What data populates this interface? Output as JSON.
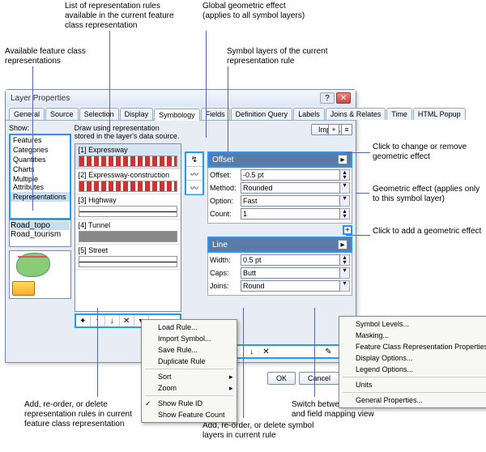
{
  "annotations": {
    "a1": "List of representation rules available in the current feature class representation",
    "a2": "Global geometric effect (applies to all symbol layers)",
    "a3": "Available feature class representations",
    "a4": "Symbol layers of the current representation rule",
    "a5": "Click to change or remove geometric effect",
    "a6": "Geometric effect (applies only to this symbol layer)",
    "a7": "Click to add a geometric effect",
    "a8": "Add, re-order, or delete representation rules in current feature class representation",
    "a9": "Add, re-order, or delete symbol layers in current rule",
    "a10": "Switch between default values and field mapping view"
  },
  "dialog": {
    "title": "Layer Properties",
    "tabs": [
      "General",
      "Source",
      "Selection",
      "Display",
      "Symbology",
      "Fields",
      "Definition Query",
      "Labels",
      "Joins & Relates",
      "Time",
      "HTML Popup"
    ],
    "active_tab": "Symbology",
    "show_label": "Show:",
    "show_items": [
      "Features",
      "Categories",
      "Quantities",
      "Charts",
      "Multiple Attributes",
      "Representations"
    ],
    "rep_items": [
      "Road_topo",
      "Road_tourism"
    ],
    "top_text": "Draw using representation stored in the layer's data source.",
    "import": "Import...",
    "rules": [
      {
        "label": "[1] Expressway"
      },
      {
        "label": "[2] Expressway-construction"
      },
      {
        "label": "[3] Highway"
      },
      {
        "label": "[4] Tunnel"
      },
      {
        "label": "[5] Street"
      }
    ],
    "offset_hdr": "Offset",
    "offset": {
      "Offset": "-0.5 pt",
      "Method": "Rounded",
      "Option": "Fast",
      "Count": "1"
    },
    "line_hdr": "Line",
    "line": {
      "Width": "0.5 pt",
      "Caps": "Butt",
      "Joins": "Round"
    },
    "ok": "OK",
    "cancel": "Cancel"
  },
  "menu1": [
    "Load Rule...",
    "Import Symbol...",
    "Save Rule...",
    "Duplicate Rule",
    "Sort",
    "Zoom",
    "Show Rule ID",
    "Show Feature Count"
  ],
  "menu2": [
    "Symbol Levels...",
    "Masking...",
    "Feature Class Representation Properties...",
    "Display Options...",
    "Legend Options...",
    "Units",
    "General Properties..."
  ]
}
